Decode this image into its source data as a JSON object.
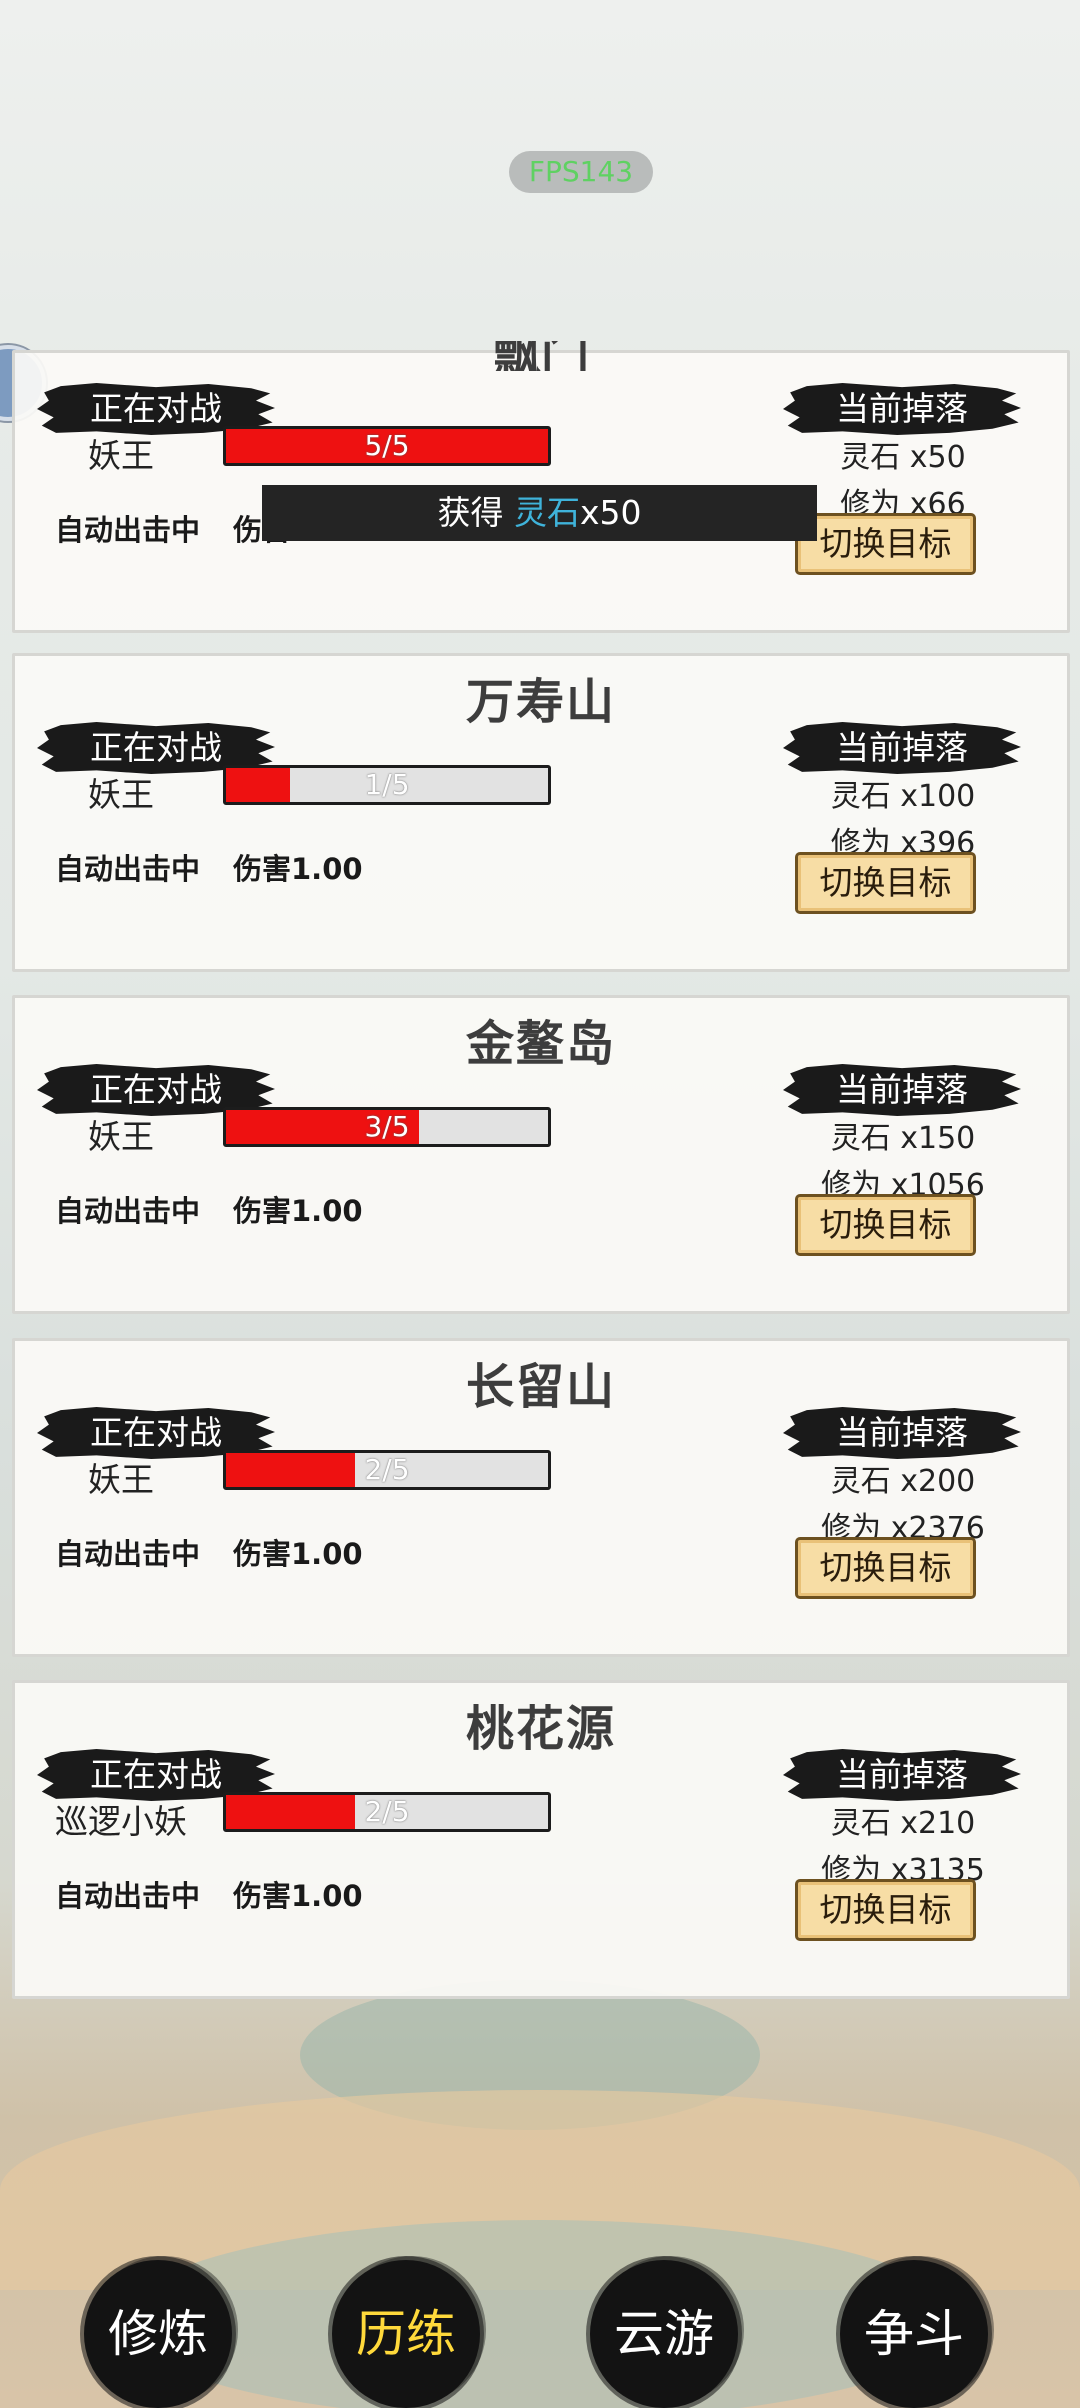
{
  "fps_label": "FPS143",
  "toast": {
    "prefix": "获得 ",
    "item": "灵石",
    "suffix": "x50"
  },
  "card_labels": {
    "battle": "正在对战",
    "drop": "当前掉落",
    "auto": "自动出击中",
    "switch": "切换目标"
  },
  "areas": [
    {
      "title": "飘门",
      "monster": "妖王",
      "hp_text": "5/5",
      "hp_current": 5,
      "hp_max": 5,
      "damage": "伤害1.00",
      "drop_stone": "灵石 x50",
      "drop_cultivation": "修为 x66"
    },
    {
      "title": "万寿山",
      "monster": "妖王",
      "hp_text": "1/5",
      "hp_current": 1,
      "hp_max": 5,
      "damage": "伤害1.00",
      "drop_stone": "灵石 x100",
      "drop_cultivation": "修为 x396"
    },
    {
      "title": "金鳌岛",
      "monster": "妖王",
      "hp_text": "3/5",
      "hp_current": 3,
      "hp_max": 5,
      "damage": "伤害1.00",
      "drop_stone": "灵石 x150",
      "drop_cultivation": "修为 x1056"
    },
    {
      "title": "长留山",
      "monster": "妖王",
      "hp_text": "2/5",
      "hp_current": 2,
      "hp_max": 5,
      "damage": "伤害1.00",
      "drop_stone": "灵石 x200",
      "drop_cultivation": "修为 x2376"
    },
    {
      "title": "桃花源",
      "monster": "巡逻小妖",
      "hp_text": "2/5",
      "hp_current": 2,
      "hp_max": 5,
      "damage": "伤害1.00",
      "drop_stone": "灵石 x210",
      "drop_cultivation": "修为 x3135"
    }
  ],
  "nav": [
    {
      "label": "修炼",
      "active": false
    },
    {
      "label": "历练",
      "active": true
    },
    {
      "label": "云游",
      "active": false
    },
    {
      "label": "争斗",
      "active": false
    }
  ],
  "colors": {
    "hp_fill": "#ee1111",
    "nav_active": "#ffd93b",
    "fps_text": "#5fd162",
    "toast_highlight": "#3fb3da"
  }
}
